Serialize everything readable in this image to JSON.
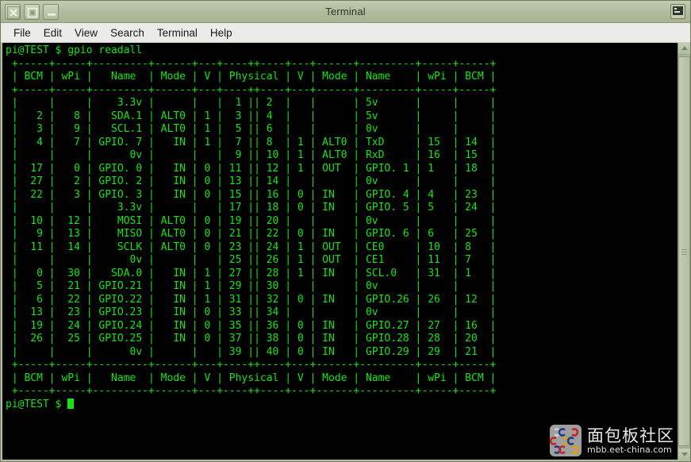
{
  "window": {
    "title": "Terminal",
    "buttons": [
      {
        "name": "close-button",
        "glyph": "x"
      },
      {
        "name": "maximize-button",
        "glyph": "square"
      },
      {
        "name": "minimize-button",
        "glyph": "dash"
      }
    ],
    "app_icon": "terminal-icon"
  },
  "menubar": {
    "items": [
      "File",
      "Edit",
      "View",
      "Search",
      "Terminal",
      "Help"
    ]
  },
  "terminal": {
    "prompt": "pi@TEST $ ",
    "command": "gpio readall",
    "prompt_trailing": "pi@TEST $ ",
    "colors": {
      "background": "#000000",
      "foreground": "#14e414"
    },
    "separator": "+-----+-----+---------+------+---+----++----+---+------+---------+-----+-----+",
    "header": "| BCM | wPi |   Name  | Mode | V | Physical | V | Mode | Name    | wPi | BCM |",
    "rows": [
      "|     |     |    3.3v |      |   |  1 || 2  |   |      | 5v      |     |     |",
      "|   2 |   8 |   SDA.1 | ALT0 | 1 |  3 || 4  |   |      | 5v      |     |     |",
      "|   3 |   9 |   SCL.1 | ALT0 | 1 |  5 || 6  |   |      | 0v      |     |     |",
      "|   4 |   7 | GPIO. 7 |   IN | 1 |  7 || 8  | 1 | ALT0 | TxD     | 15  | 14  |",
      "|     |     |      0v |      |   |  9 || 10 | 1 | ALT0 | RxD     | 16  | 15  |",
      "|  17 |   0 | GPIO. 0 |   IN | 0 | 11 || 12 | 1 | OUT  | GPIO. 1 | 1   | 18  |",
      "|  27 |   2 | GPIO. 2 |   IN | 0 | 13 || 14 |   |      | 0v      |     |     |",
      "|  22 |   3 | GPIO. 3 |   IN | 0 | 15 || 16 | 0 | IN   | GPIO. 4 | 4   | 23  |",
      "|     |     |    3.3v |      |   | 17 || 18 | 0 | IN   | GPIO. 5 | 5   | 24  |",
      "|  10 |  12 |    MOSI | ALT0 | 0 | 19 || 20 |   |      | 0v      |     |     |",
      "|   9 |  13 |    MISO | ALT0 | 0 | 21 || 22 | 0 | IN   | GPIO. 6 | 6   | 25  |",
      "|  11 |  14 |    SCLK | ALT0 | 0 | 23 || 24 | 1 | OUT  | CE0     | 10  | 8   |",
      "|     |     |      0v |      |   | 25 || 26 | 1 | OUT  | CE1     | 11  | 7   |",
      "|   0 |  30 |   SDA.0 |   IN | 1 | 27 || 28 | 1 | IN   | SCL.0   | 31  | 1   |",
      "|   5 |  21 | GPIO.21 |   IN | 1 | 29 || 30 |   |      | 0v      |     |     |",
      "|   6 |  22 | GPIO.22 |   IN | 1 | 31 || 32 | 0 | IN   | GPIO.26 | 26  | 12  |",
      "|  13 |  23 | GPIO.23 |   IN | 0 | 33 || 34 |   |      | 0v      |     |     |",
      "|  19 |  24 | GPIO.24 |   IN | 0 | 35 || 36 | 0 | IN   | GPIO.27 | 27  | 16  |",
      "|  26 |  25 | GPIO.25 |   IN | 0 | 37 || 38 | 0 | IN   | GPIO.28 | 28  | 20  |",
      "|     |     |      0v |      |   | 39 || 40 | 0 | IN   | GPIO.29 | 29  | 21  |"
    ]
  },
  "scrollbar": {
    "up_arrow": "scroll-up-arrow",
    "down_arrow": "scroll-down-arrow"
  },
  "watermark": {
    "name_cn": "面包板社区",
    "url": "mbb.eet-china.com"
  }
}
